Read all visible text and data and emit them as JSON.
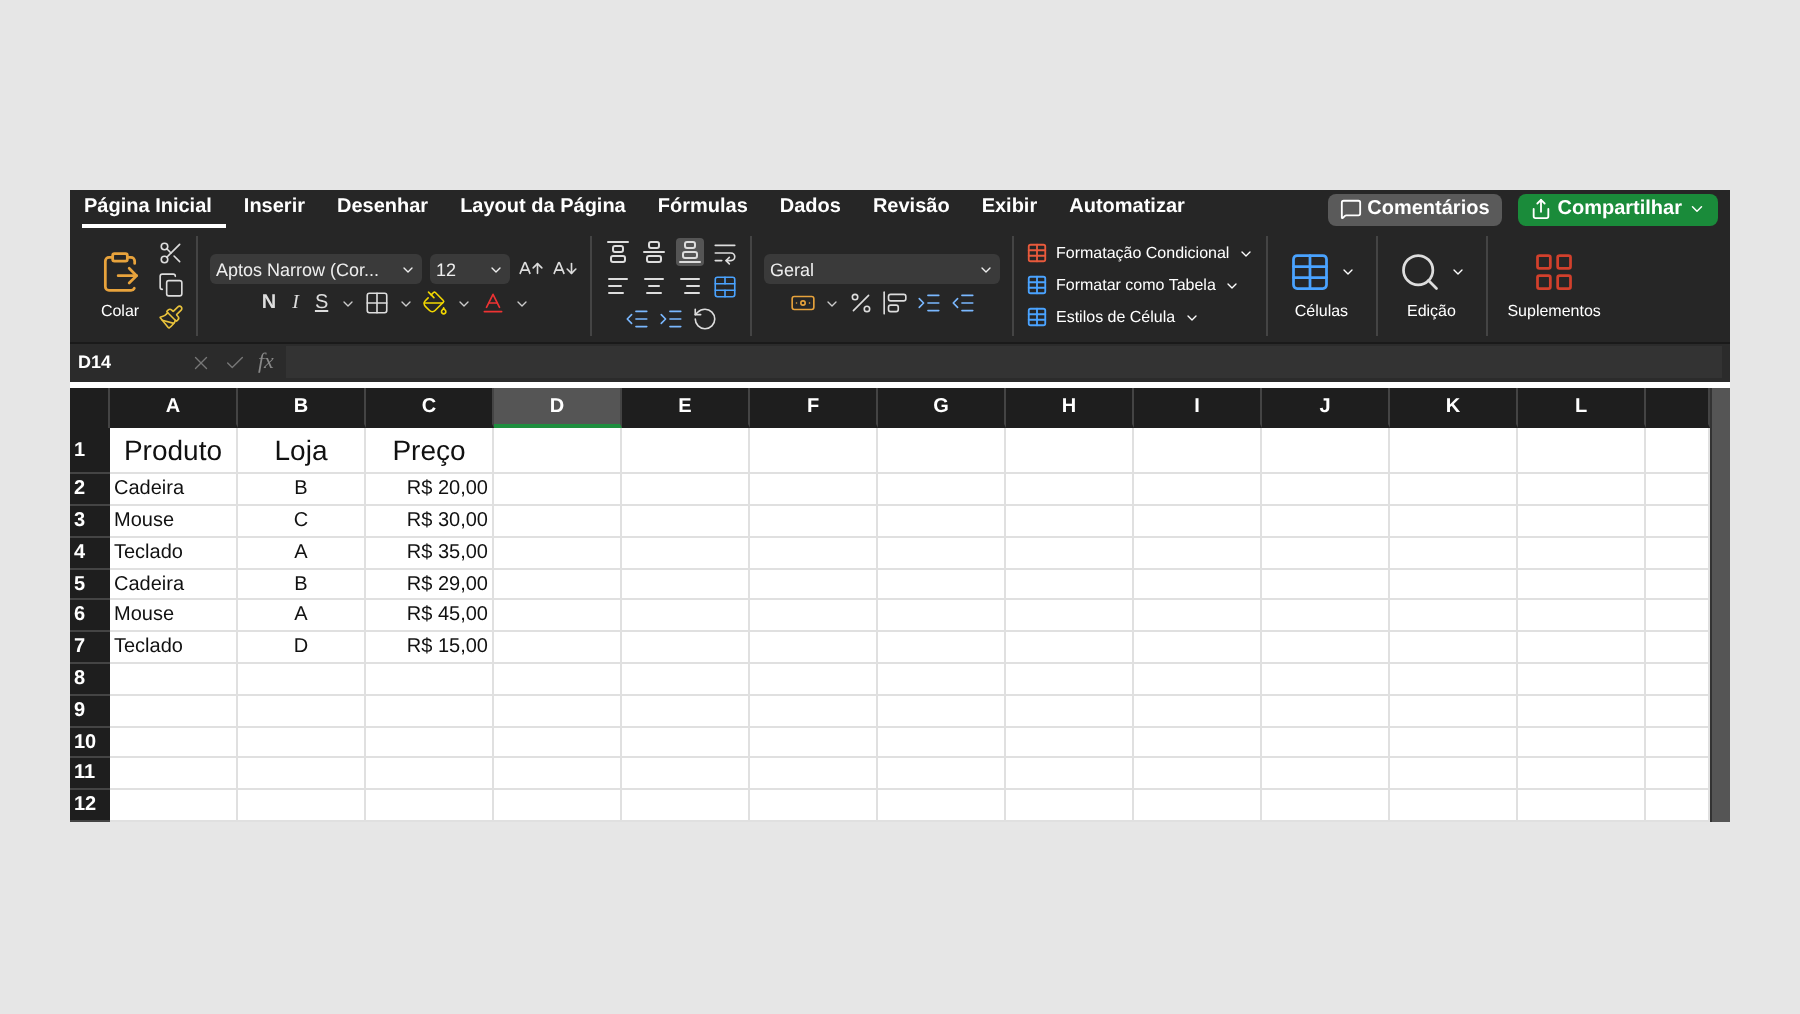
{
  "tabs": [
    {
      "label": "Página Inicial",
      "selected": true
    },
    {
      "label": "Inserir",
      "selected": false
    },
    {
      "label": "Desenhar",
      "selected": false
    },
    {
      "label": "Layout da Página",
      "selected": false
    },
    {
      "label": "Fórmulas",
      "selected": false
    },
    {
      "label": "Dados",
      "selected": false
    },
    {
      "label": "Revisão",
      "selected": false
    },
    {
      "label": "Exibir",
      "selected": false
    },
    {
      "label": "Automatizar",
      "selected": false
    }
  ],
  "comments_button": "Comentários",
  "share_button": "Compartilhar",
  "ribbon": {
    "paste_label": "Colar",
    "font_name": "Aptos Narrow (Cor...",
    "font_size": "12",
    "format_buttons": [
      {
        "label": "N",
        "kind": "bold"
      },
      {
        "label": "I",
        "kind": "italic"
      },
      {
        "label": "S",
        "kind": "underline"
      }
    ],
    "alignment": [
      {
        "kind": "top",
        "selected": false
      },
      {
        "kind": "middle",
        "selected": false
      },
      {
        "kind": "bottom",
        "selected": true
      },
      {
        "kind": "left",
        "selected": false
      },
      {
        "kind": "center",
        "selected": false
      },
      {
        "kind": "right",
        "selected": false
      }
    ],
    "number_format": "Geral",
    "styles": [
      {
        "label": "Formatação Condicional"
      },
      {
        "label": "Formatar como Tabela"
      },
      {
        "label": "Estilos de Célula"
      }
    ],
    "cells_label": "Células",
    "editing_label": "Edição",
    "addins_label": "Suplementos"
  },
  "formula_bar": {
    "name_box": "D14",
    "function_label": "fx"
  },
  "grid": {
    "columns": [
      {
        "label": "A",
        "selected": false
      },
      {
        "label": "B",
        "selected": false
      },
      {
        "label": "C",
        "selected": false
      },
      {
        "label": "D",
        "selected": true
      },
      {
        "label": "E",
        "selected": false
      },
      {
        "label": "F",
        "selected": false
      },
      {
        "label": "G",
        "selected": false
      },
      {
        "label": "H",
        "selected": false
      },
      {
        "label": "I",
        "selected": false
      },
      {
        "label": "J",
        "selected": false
      },
      {
        "label": "K",
        "selected": false
      },
      {
        "label": "L",
        "selected": false
      }
    ],
    "rows": [
      {
        "number": "1",
        "kind": "header",
        "cells": [
          "Produto",
          "Loja",
          "Preço"
        ]
      },
      {
        "number": "2",
        "kind": "data",
        "cells": [
          "Cadeira",
          "B",
          "R$ 20,00"
        ]
      },
      {
        "number": "3",
        "kind": "data",
        "cells": [
          "Mouse",
          "C",
          "R$ 30,00"
        ]
      },
      {
        "number": "4",
        "kind": "data",
        "cells": [
          "Teclado",
          "A",
          "R$ 35,00"
        ]
      },
      {
        "number": "5",
        "kind": "data",
        "cells": [
          "Cadeira",
          "B",
          "R$ 29,00"
        ]
      },
      {
        "number": "6",
        "kind": "data",
        "cells": [
          "Mouse",
          "A",
          "R$ 45,00"
        ]
      },
      {
        "number": "7",
        "kind": "data",
        "cells": [
          "Teclado",
          "D",
          "R$ 15,00"
        ]
      },
      {
        "number": "8",
        "kind": "data",
        "cells": []
      },
      {
        "number": "9",
        "kind": "data",
        "cells": []
      },
      {
        "number": "10",
        "kind": "data",
        "cells": []
      },
      {
        "number": "11",
        "kind": "data",
        "cells": []
      },
      {
        "number": "12",
        "kind": "data",
        "cells": []
      }
    ]
  }
}
